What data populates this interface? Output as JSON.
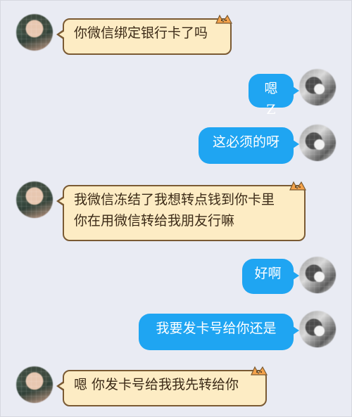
{
  "conversation": {
    "messages": [
      {
        "from": "peer",
        "text": "你微信绑定银行卡了吗"
      },
      {
        "from": "self",
        "text": "嗯 Z"
      },
      {
        "from": "self",
        "text": "这必须的呀"
      },
      {
        "from": "peer",
        "text": "我微信冻结了我想转点钱到你卡里\n你在用微信转给我朋友行嘛"
      },
      {
        "from": "self",
        "text": "好啊"
      },
      {
        "from": "self",
        "text": "我要发卡号给你还是"
      },
      {
        "from": "peer",
        "text": "嗯 你发卡号给我我先转给你"
      }
    ]
  },
  "colors": {
    "background": "#e9ebf3",
    "peer_bubble": "#fdecc4",
    "peer_border": "#7a5a33",
    "self_bubble": "#1fa5f2"
  },
  "icons": {
    "peer_avatar": "avatar-peer-icon",
    "self_avatar": "avatar-self-icon",
    "bubble_decoration": "cat-ears-icon"
  }
}
